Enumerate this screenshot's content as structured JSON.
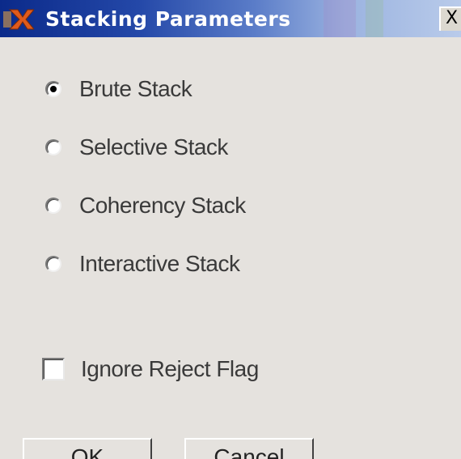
{
  "window": {
    "title": "Stacking Parameters",
    "close_glyph": "X",
    "icon": "x-app-icon"
  },
  "options": [
    {
      "label": "Brute Stack",
      "checked": true
    },
    {
      "label": "Selective Stack",
      "checked": false
    },
    {
      "label": "Coherency Stack",
      "checked": false
    },
    {
      "label": "Interactive Stack",
      "checked": false
    }
  ],
  "ignore_reject": {
    "label": "Ignore Reject Flag",
    "checked": false
  },
  "buttons": {
    "ok": "OK",
    "cancel": "Cancel"
  },
  "colors": {
    "titlebar_start": "#0b2a8a",
    "titlebar_end": "#b9cbea",
    "dialog_bg": "#e5e2de",
    "icon_orange": "#e05a1c"
  }
}
